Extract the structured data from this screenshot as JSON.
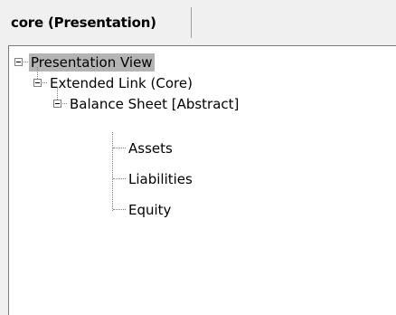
{
  "tab": {
    "label": "core (Presentation)"
  },
  "tree": {
    "nodes": [
      {
        "label": "Presentation View",
        "selected": true,
        "expanded": true
      },
      {
        "label": "Extended Link (Core)",
        "selected": false,
        "expanded": true
      },
      {
        "label": "Balance Sheet [Abstract]",
        "selected": false,
        "expanded": true
      },
      {
        "label": "Assets",
        "selected": false
      },
      {
        "label": "Liabilities",
        "selected": false
      },
      {
        "label": "Equity",
        "selected": false
      }
    ]
  },
  "colors": {
    "selection": "#b4b4b4",
    "tree_lines": "#808080"
  }
}
